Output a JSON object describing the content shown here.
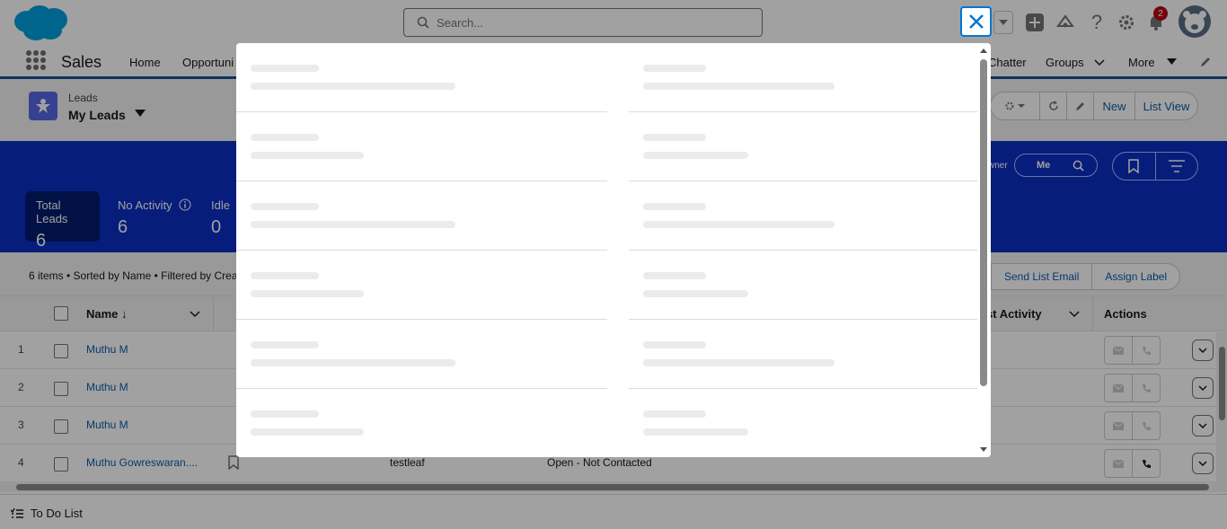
{
  "header": {
    "search_placeholder": "Search...",
    "notification_count": "2"
  },
  "nav": {
    "app_name": "Sales",
    "items": [
      "Home",
      "Opportuni",
      "Chatter",
      "Groups",
      "More"
    ]
  },
  "page_header": {
    "object_label": "Leads",
    "list_view_name": "My Leads",
    "buttons": [
      "New",
      "List View"
    ]
  },
  "kpis": [
    {
      "label": "Total Leads",
      "value": "6"
    },
    {
      "label": "No Activity",
      "value": "6"
    },
    {
      "label": "Idle",
      "value": "0"
    }
  ],
  "owner_filter": {
    "label": "wner",
    "value": "Me"
  },
  "list_info": {
    "summary": "6 items • Sorted by Name • Filtered by Crea",
    "buttons": [
      "r",
      "Send List Email",
      "Assign Label"
    ]
  },
  "table": {
    "columns": {
      "name": "Name ↓",
      "last_activity": "st Activity",
      "actions": "Actions"
    },
    "rows": [
      {
        "num": "1",
        "name": "Muthu M",
        "company": "",
        "status": ""
      },
      {
        "num": "2",
        "name": "Muthu M",
        "company": "",
        "status": ""
      },
      {
        "num": "3",
        "name": "Muthu M",
        "company": "",
        "status": ""
      },
      {
        "num": "4",
        "name": "Muthu Gowreswaran....",
        "company": "testleaf",
        "status": "Open - Not Contacted"
      }
    ]
  },
  "utility_bar": {
    "todo_label": "To Do List"
  },
  "colors": {
    "brand_blue": "#0b2fc4",
    "link": "#0b5cab",
    "overlay": "rgba(0,0,0,0.37)"
  }
}
